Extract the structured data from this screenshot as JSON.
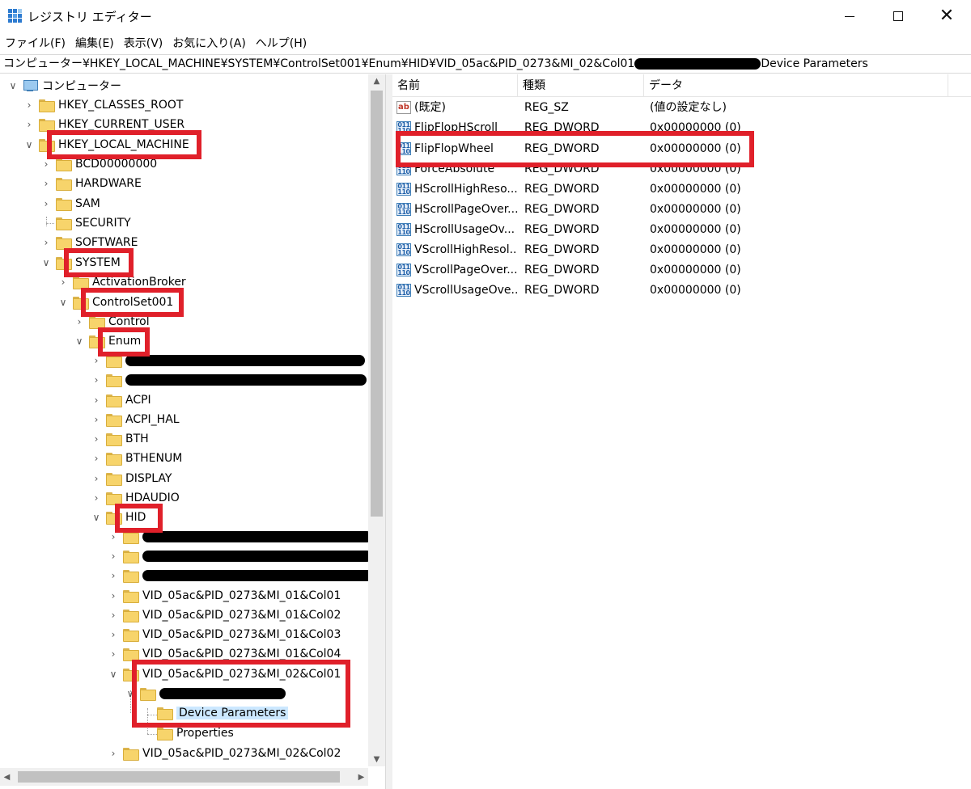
{
  "window": {
    "title": "レジストリ エディター",
    "minimize": "—",
    "maximize": "☐",
    "close": "✕"
  },
  "menu": [
    "ファイル(F)",
    "編集(E)",
    "表示(V)",
    "お気に入り(A)",
    "ヘルプ(H)"
  ],
  "address": {
    "prefix": "コンピューター¥HKEY_LOCAL_MACHINE¥SYSTEM¥ControlSet001¥Enum¥HID¥VID_05ac&PID_0273&MI_02&Col01",
    "suffix": "Device Parameters"
  },
  "tree": {
    "root": "コンピューター",
    "hkcr": "HKEY_CLASSES_ROOT",
    "hkcu": "HKEY_CURRENT_USER",
    "hklm": "HKEY_LOCAL_MACHINE",
    "bcd": "BCD00000000",
    "hardware": "HARDWARE",
    "sam": "SAM",
    "security": "SECURITY",
    "software": "SOFTWARE",
    "system": "SYSTEM",
    "activation_broker": "ActivationBroker",
    "controlset001": "ControlSet001",
    "control": "Control",
    "enum": "Enum",
    "acpi": "ACPI",
    "acpi_hal": "ACPI_HAL",
    "bth": "BTH",
    "bthenum": "BTHENUM",
    "display": "DISPLAY",
    "hdaudio": "HDAUDIO",
    "hid": "HID",
    "vid_mi01_col01": "VID_05ac&PID_0273&MI_01&Col01",
    "vid_mi01_col02": "VID_05ac&PID_0273&MI_01&Col02",
    "vid_mi01_col03": "VID_05ac&PID_0273&MI_01&Col03",
    "vid_mi01_col04": "VID_05ac&PID_0273&MI_01&Col04",
    "vid_mi02_col01": "VID_05ac&PID_0273&MI_02&Col01",
    "device_parameters": "Device Parameters",
    "properties": "Properties",
    "vid_mi02_col02": "VID_05ac&PID_0273&MI_02&Col02"
  },
  "values": {
    "headers": {
      "name": "名前",
      "type": "種類",
      "data": "データ"
    },
    "rows": [
      {
        "icon": "string-value-icon",
        "name": "(既定)",
        "type": "REG_SZ",
        "data": "(値の設定なし)"
      },
      {
        "icon": "dword-value-icon",
        "name": "FlipFlopHScroll",
        "type": "REG_DWORD",
        "data": "0x00000000 (0)"
      },
      {
        "icon": "dword-value-icon",
        "name": "FlipFlopWheel",
        "type": "REG_DWORD",
        "data": "0x00000000 (0)"
      },
      {
        "icon": "dword-value-icon",
        "name": "ForceAbsolute",
        "type": "REG_DWORD",
        "data": "0x00000000 (0)"
      },
      {
        "icon": "dword-value-icon",
        "name": "HScrollHighReso...",
        "type": "REG_DWORD",
        "data": "0x00000000 (0)"
      },
      {
        "icon": "dword-value-icon",
        "name": "HScrollPageOver...",
        "type": "REG_DWORD",
        "data": "0x00000000 (0)"
      },
      {
        "icon": "dword-value-icon",
        "name": "HScrollUsageOv...",
        "type": "REG_DWORD",
        "data": "0x00000000 (0)"
      },
      {
        "icon": "dword-value-icon",
        "name": "VScrollHighResol...",
        "type": "REG_DWORD",
        "data": "0x00000000 (0)"
      },
      {
        "icon": "dword-value-icon",
        "name": "VScrollPageOver...",
        "type": "REG_DWORD",
        "data": "0x00000000 (0)"
      },
      {
        "icon": "dword-value-icon",
        "name": "VScrollUsageOve...",
        "type": "REG_DWORD",
        "data": "0x00000000 (0)"
      }
    ]
  },
  "icons": {
    "string": "ab",
    "dword": "011 110"
  },
  "colors": {
    "highlight_box": "#e0202a",
    "selection": "#cce8ff",
    "folder": "#f7d46b"
  }
}
